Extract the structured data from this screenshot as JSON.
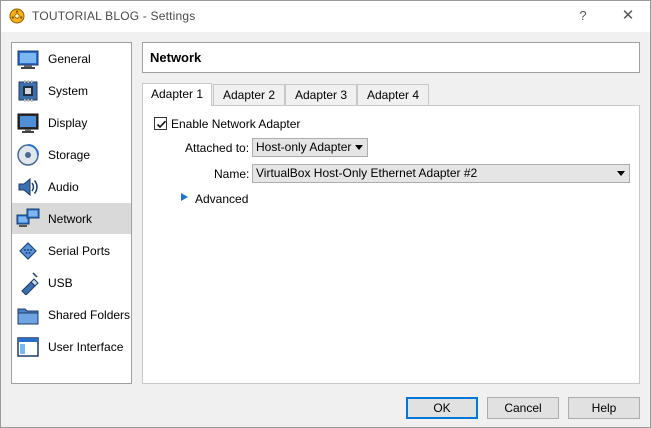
{
  "window": {
    "title": "TOUTORIAL BLOG - Settings",
    "help_symbol": "?",
    "close_symbol": "✕"
  },
  "sidebar": {
    "items": [
      {
        "label": "General",
        "icon": "general-icon"
      },
      {
        "label": "System",
        "icon": "system-icon"
      },
      {
        "label": "Display",
        "icon": "display-icon"
      },
      {
        "label": "Storage",
        "icon": "storage-icon"
      },
      {
        "label": "Audio",
        "icon": "audio-icon"
      },
      {
        "label": "Network",
        "icon": "network-icon",
        "selected": true
      },
      {
        "label": "Serial Ports",
        "icon": "serial-ports-icon"
      },
      {
        "label": "USB",
        "icon": "usb-icon"
      },
      {
        "label": "Shared Folders",
        "icon": "shared-folders-icon"
      },
      {
        "label": "User Interface",
        "icon": "user-interface-icon"
      }
    ]
  },
  "page": {
    "title": "Network"
  },
  "tabs": [
    {
      "label": "Adapter 1",
      "active": true
    },
    {
      "label": "Adapter 2"
    },
    {
      "label": "Adapter 3"
    },
    {
      "label": "Adapter 4"
    }
  ],
  "adapter": {
    "enable_label": "Enable Network Adapter",
    "enabled": true,
    "attached_to_label": "Attached to:",
    "attached_to_value": "Host-only Adapter",
    "name_label": "Name:",
    "name_value": "VirtualBox Host-Only Ethernet Adapter #2",
    "advanced_label": "Advanced"
  },
  "buttons": {
    "ok": "OK",
    "cancel": "Cancel",
    "help": "Help"
  },
  "colors": {
    "accent": "#0078d7",
    "selected_row": "#d9d9d9"
  }
}
